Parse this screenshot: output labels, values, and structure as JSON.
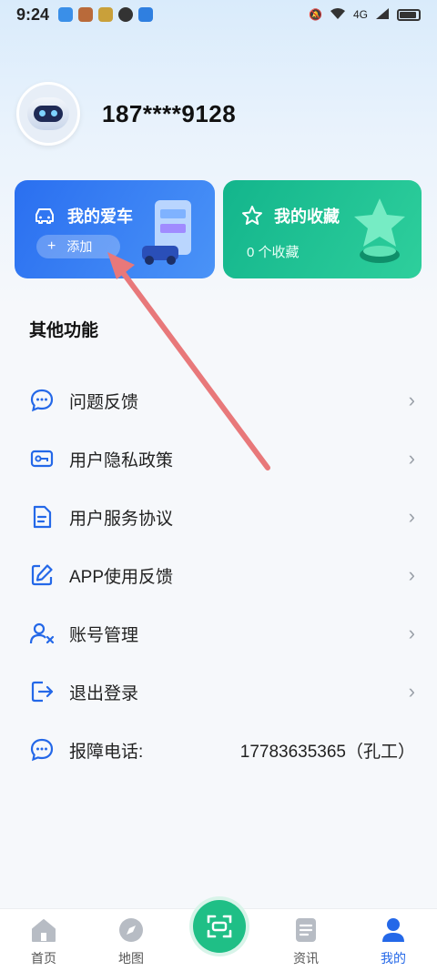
{
  "status_bar": {
    "time": "9:24",
    "network": "4G"
  },
  "profile": {
    "phone": "187****9128"
  },
  "cards": {
    "car": {
      "title": "我的爱车",
      "add_label": "添加",
      "plus": "+"
    },
    "fav": {
      "title": "我的收藏",
      "count_text": "0 个收藏"
    }
  },
  "section": {
    "title": "其他功能"
  },
  "menu": [
    {
      "label": "问题反馈",
      "icon": "chat-bubble-icon"
    },
    {
      "label": "用户隐私政策",
      "icon": "key-card-icon"
    },
    {
      "label": "用户服务协议",
      "icon": "document-icon"
    },
    {
      "label": "APP使用反馈",
      "icon": "edit-icon"
    },
    {
      "label": "账号管理",
      "icon": "user-x-icon"
    },
    {
      "label": "退出登录",
      "icon": "logout-icon"
    }
  ],
  "hotline": {
    "label": "报障电话:",
    "value": "17783635365（孔工）"
  },
  "tabs": [
    {
      "label": "首页",
      "icon": "home-icon"
    },
    {
      "label": "地图",
      "icon": "compass-icon"
    },
    {
      "label": "",
      "icon": "scan-icon"
    },
    {
      "label": "资讯",
      "icon": "news-icon"
    },
    {
      "label": "我的",
      "icon": "user-icon"
    }
  ],
  "colors": {
    "accent": "#2468e8",
    "green": "#1fbf86",
    "arrow": "#e8787a"
  }
}
